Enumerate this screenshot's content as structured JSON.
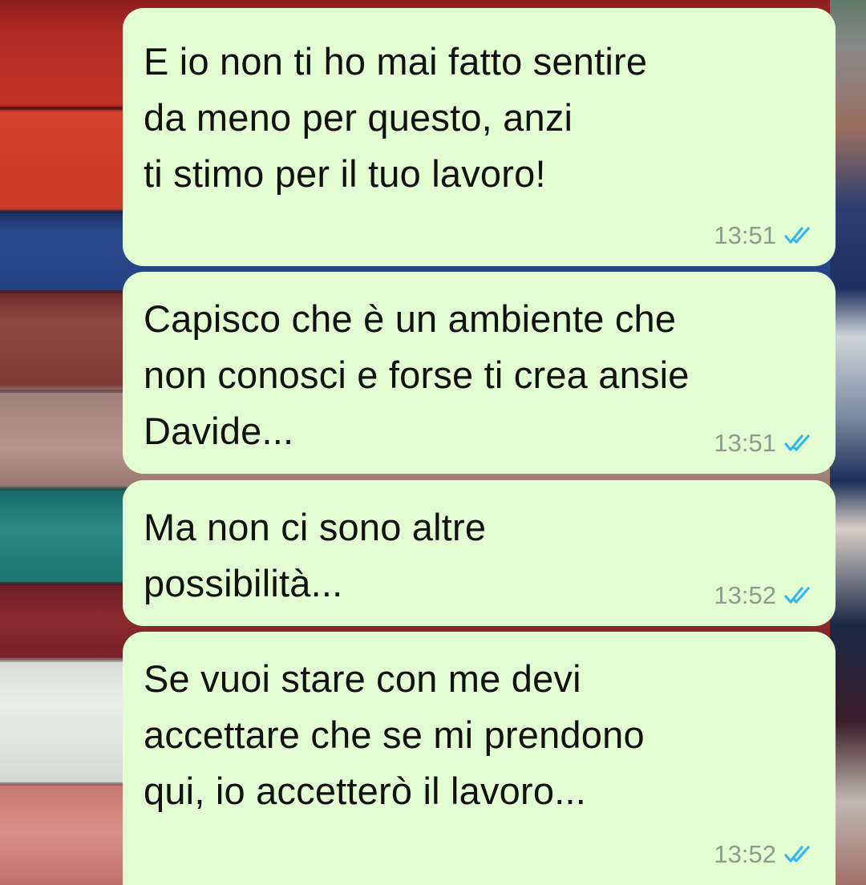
{
  "conversation": {
    "messages": [
      {
        "text": "E io non ti ho mai fatto sentire\nda meno per questo, anzi\nti stimo per il tuo lavoro!",
        "time": "13:51",
        "status_icon": "double-check-read-icon"
      },
      {
        "text": "Capisco che è un ambiente che\nnon conosci e forse ti crea ansie\nDavide...",
        "time": "13:51",
        "status_icon": "double-check-read-icon"
      },
      {
        "text": "Ma non ci sono altre\npossibilità...",
        "time": "13:52",
        "status_icon": "double-check-read-icon"
      },
      {
        "text": "Se vuoi stare con me devi\naccettare che se mi prendono\nqui, io accetterò il lavoro...",
        "time": "13:52",
        "status_icon": "double-check-read-icon"
      }
    ]
  },
  "colors": {
    "outgoing_bubble": "#e2fdd2",
    "read_tick": "#34b7f1",
    "timestamp": "#8f9a8c"
  }
}
